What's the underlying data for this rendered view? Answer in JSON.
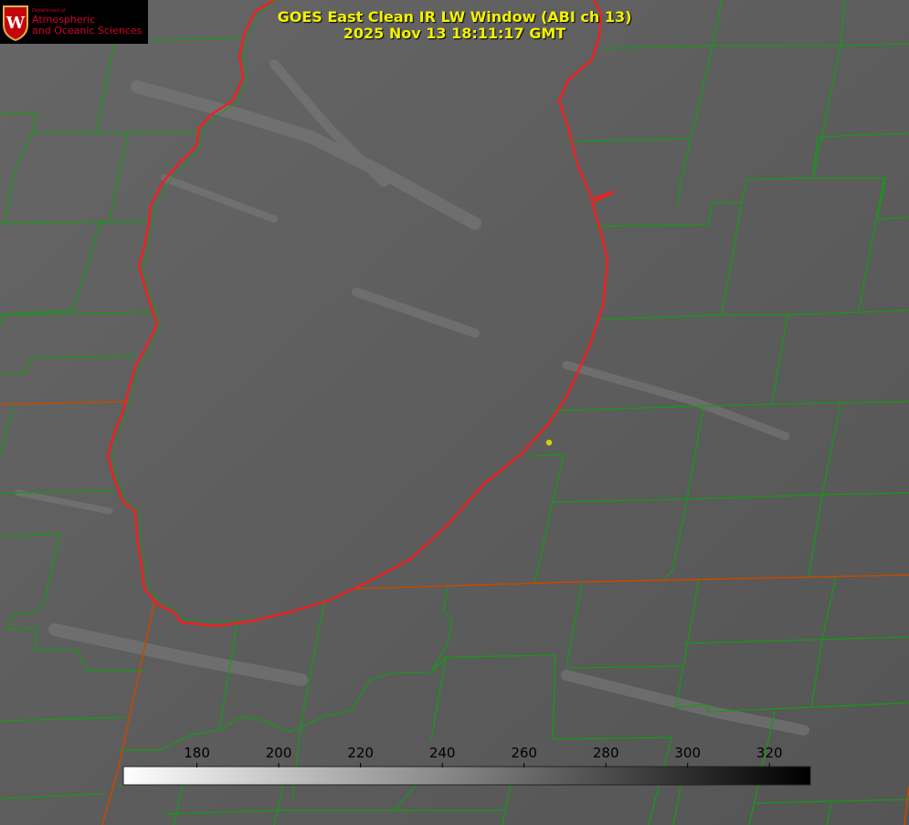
{
  "title": {
    "line1": "GOES East Clean IR LW Window (ABI ch 13)",
    "line2": "2025 Nov 13 18:11:17 GMT"
  },
  "logo": {
    "department": "Department of",
    "line1": "Atmospheric",
    "line2": "and Oceanic Sciences",
    "crest_letter": "W",
    "crest_color": "#c5050c"
  },
  "colorbar": {
    "min": 162,
    "max": 330,
    "ticks": [
      180,
      200,
      220,
      240,
      260,
      280,
      300,
      320
    ],
    "ramp": "white-to-black"
  },
  "colors": {
    "lake_outline": "#ff1a1a",
    "county_lines": "#159a15",
    "state_lines": "#c24a00",
    "title_text": "#f2f200",
    "marker": "#d8d000",
    "background_gray": "#5c5c5c"
  },
  "map": {
    "feature": "Lake Michigan shoreline with county boundaries",
    "marker_icon": "location-dot-icon"
  }
}
